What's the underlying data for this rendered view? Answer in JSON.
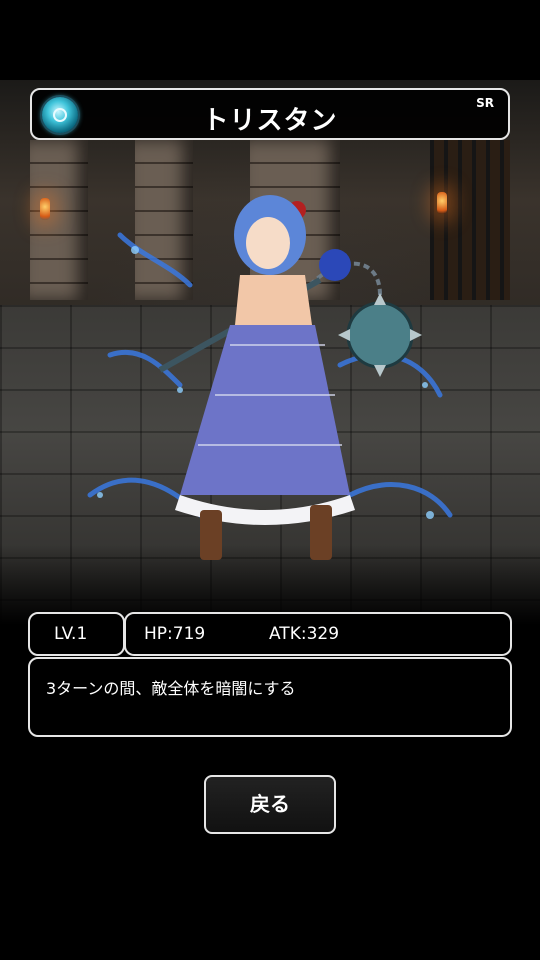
{
  "header": {
    "name": "トリスタン",
    "rarity": "SR",
    "element_icon": "water-orb-icon"
  },
  "stats": {
    "level": "LV.1",
    "hp": "HP:719",
    "atk": "ATK:329"
  },
  "skill": {
    "description": "3ターンの間、敵全体を暗闇にする"
  },
  "actions": {
    "back_label": "戻る"
  },
  "colors": {
    "background": "#000000",
    "border": "#e6e6e6",
    "element_accent": "#3fc4da"
  }
}
